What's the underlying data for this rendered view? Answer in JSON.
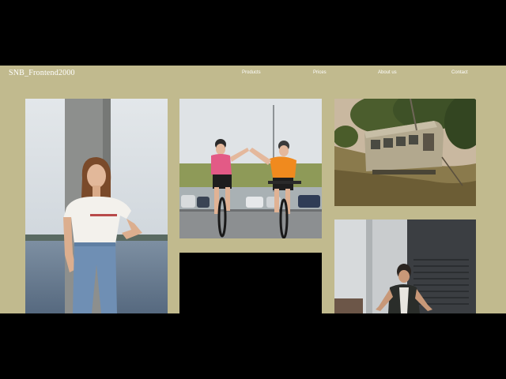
{
  "site": {
    "logo": "SNB_Frontend2000"
  },
  "nav": {
    "items": [
      {
        "label": "Products"
      },
      {
        "label": "Prices"
      },
      {
        "label": "About us"
      },
      {
        "label": "Contact"
      }
    ]
  },
  "colors": {
    "page_background": "#c1ba8e",
    "letterbox": "#000000",
    "nav_text": "#ffffff"
  },
  "gallery": {
    "photos": [
      {
        "subject": "woman-portrait"
      },
      {
        "subject": "cyclists"
      },
      {
        "subject": "abandoned-trailer"
      },
      {
        "subject": "dark-tile"
      },
      {
        "subject": "urban-man"
      }
    ]
  }
}
